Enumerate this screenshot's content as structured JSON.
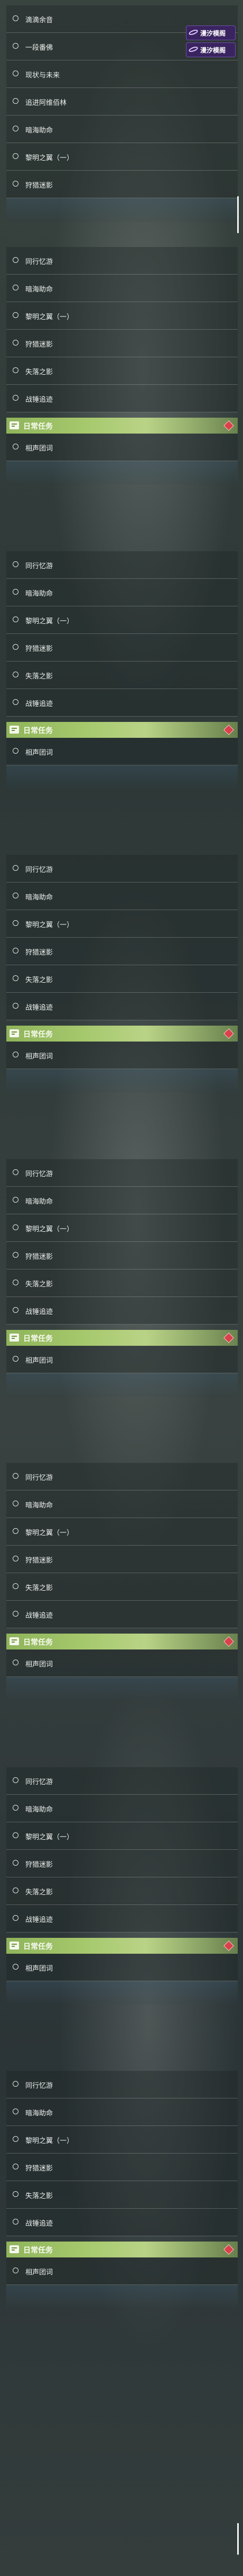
{
  "top_tasks": [
    {
      "label": "滴滴余音"
    },
    {
      "label": "一段番佛"
    },
    {
      "label": "现状与未来"
    },
    {
      "label": "追进阿维佰林"
    },
    {
      "label": "暗海助命"
    },
    {
      "label": "黎明之翼（一）"
    },
    {
      "label": "狩猎迷影"
    }
  ],
  "brand": {
    "name": "漫汐模阁",
    "name2": "漫汐模阁"
  },
  "section_tasks": [
    {
      "label": "同行忆游"
    },
    {
      "label": "暗海助命"
    },
    {
      "label": "黎明之翼（一）"
    },
    {
      "label": "狩猎迷影"
    },
    {
      "label": "失落之影"
    },
    {
      "label": "战锤追迹"
    }
  ],
  "daily": {
    "title": "日常任务",
    "item": "相声团词"
  },
  "colors": {
    "accent": "#a7c96e",
    "alert": "#d9424a",
    "brand_bg": "#3a2460"
  }
}
